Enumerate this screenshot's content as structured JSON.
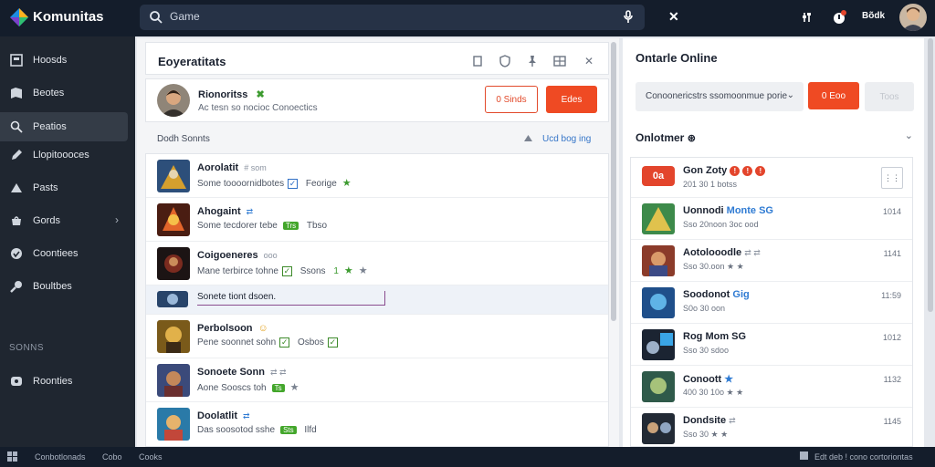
{
  "app": {
    "name": "Komunitas",
    "user": "Bõdk"
  },
  "search": {
    "value": "Game",
    "placeholder": "Game"
  },
  "sidebar": {
    "items": [
      {
        "label": "Hoosds",
        "icon": "home-icon"
      },
      {
        "label": "Beotes",
        "icon": "bookmark-icon"
      },
      {
        "label": "Peatios",
        "icon": "search-icon",
        "active": true
      },
      {
        "label": "Llopitoooces",
        "icon": "pencil-icon"
      },
      {
        "label": "Pasts",
        "icon": "triangle-icon"
      },
      {
        "label": "Gords",
        "icon": "cart-icon",
        "chevron": "›"
      },
      {
        "label": "Coontiees",
        "icon": "globe-icon"
      },
      {
        "label": "Boultbes",
        "icon": "tools-icon"
      }
    ],
    "section_title": "SONNS",
    "section_items": [
      {
        "label": "Roonties",
        "icon": "gamepad-icon"
      }
    ]
  },
  "bottom_bar": {
    "items": [
      "Conbotlonads",
      "Cobo",
      "Cooks"
    ],
    "right_text": "Edt deb ! cono cortoriontas"
  },
  "main": {
    "title": "Eoyeratitats",
    "profile": {
      "name": "Rionoritss",
      "badge": "✖",
      "subtitle": "Ac tesn so nocioc Conoectics",
      "btn_outline": "0  Sinds",
      "btn_solid": "Edes"
    },
    "friends_header": "Dodh Sonnts",
    "load_more": "Ucd bog ing",
    "friends": [
      {
        "name": "Aorolatit",
        "meta": "# som",
        "sub": "Some toooornidbotes",
        "extra": "Feorige",
        "check": "✓",
        "star": "★"
      },
      {
        "name": "Ahogaint",
        "meta": "⇄",
        "sub": "Some tecdorer tebe",
        "tag": "Trs",
        "extra": "Tbso"
      },
      {
        "name": "Coigoeneres",
        "meta": "ooo",
        "sub": "Mane terbirce tohne",
        "check": "✓",
        "extra": "Ssons",
        "num": "1",
        "star": "★",
        "star2": "★"
      },
      {
        "name": "Sonete tiont dsoen.",
        "selected": true
      },
      {
        "name": "Perbolsoon",
        "meta": "☺",
        "sub": "Pene soonnet sohn",
        "check": "✓",
        "extra": "Osbos",
        "check2": "✓"
      },
      {
        "name": "Sonoete Sonn",
        "meta": "⇄ ⇄",
        "sub": "Aone Sooscs toh",
        "tag": "Ts",
        "star": "★"
      },
      {
        "name": "Doolatlit",
        "meta": "⇄",
        "sub": "Das soosotod sshe",
        "tag": "Sts",
        "extra": "Ilfd"
      }
    ]
  },
  "right": {
    "title": "Ontarle Online",
    "select": {
      "value": "Conoonericstrs ssomoonmue porie",
      "chevron": "⌄"
    },
    "btn_solid": "0  Eoo",
    "btn_disabled": "Toos",
    "subtitle": "Onlotmer",
    "online": [
      {
        "name": "Gon Zoty",
        "sub": "201  30  1 botss",
        "badge": "!"
      },
      {
        "name": "Uonnodi ",
        "name_hl": "Monte SG",
        "sub": "Sso  20noon  3oc ood",
        "time": "1014"
      },
      {
        "name": "Aotolooodle",
        "name_hl": "",
        "sub": "Sso  30.oon ★ ★",
        "time": "1141"
      },
      {
        "name": "Soodonot",
        "name_hl": "Gig",
        "sub": "S0o  30  oon",
        "time": "11:59"
      },
      {
        "name": "Rog Mom SG",
        "sub": "Sso  30  sdoo",
        "time": "1012"
      },
      {
        "name": "Conoott",
        "name_hl": "★",
        "sub": "400  30  10o  ★  ★",
        "time": "1132"
      },
      {
        "name": "Dondsite",
        "sub": "Sso  30  ★ ★",
        "time": "1145"
      }
    ]
  },
  "colors": {
    "accent": "#ef4a23",
    "topbar": "#141d2b",
    "sidebar": "#1f2630",
    "online_green": "#43a62b"
  }
}
